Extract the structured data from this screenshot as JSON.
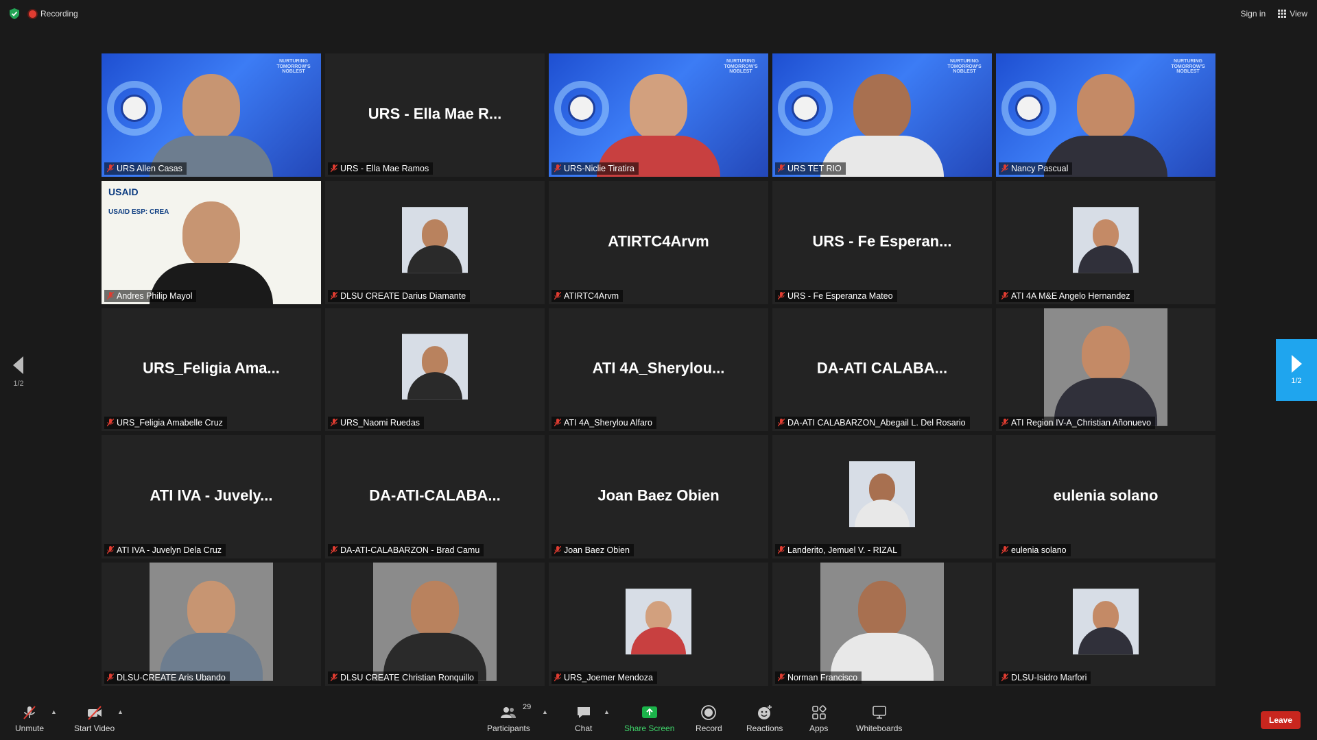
{
  "topbar": {
    "recording_label": "Recording",
    "sign_in": "Sign in",
    "view": "View"
  },
  "tiles": [
    {
      "display": "",
      "caption": "URS Allen Casas",
      "kind": "video-blue",
      "active": true
    },
    {
      "display": "URS - Ella Mae R...",
      "caption": "URS - Ella Mae Ramos",
      "kind": "name"
    },
    {
      "display": "",
      "caption": "URS-Niclie Tiratira",
      "kind": "video-blue"
    },
    {
      "display": "",
      "caption": "URS TET RIO",
      "kind": "video-blue"
    },
    {
      "display": "",
      "caption": "Nancy Pascual",
      "kind": "video-blue"
    },
    {
      "display": "",
      "caption": "Andres Philip Mayol",
      "kind": "video-white"
    },
    {
      "display": "",
      "caption": "DLSU CREATE Darius Diamante",
      "kind": "photo"
    },
    {
      "display": "ATIRTC4Arvm",
      "caption": "ATIRTC4Arvm",
      "kind": "name"
    },
    {
      "display": "URS - Fe Esperan...",
      "caption": "URS - Fe Esperanza Mateo",
      "kind": "name"
    },
    {
      "display": "",
      "caption": "ATI 4A M&E Angelo Hernandez",
      "kind": "photo"
    },
    {
      "display": "URS_Feligia  Ama...",
      "caption": "URS_Feligia Amabelle Cruz",
      "kind": "name"
    },
    {
      "display": "",
      "caption": "URS_Naomi Ruedas",
      "kind": "photo"
    },
    {
      "display": "ATI  4A_Sherylou...",
      "caption": "ATI 4A_Sherylou Alfaro",
      "kind": "name"
    },
    {
      "display": "DA-ATI  CALABA...",
      "caption": "DA-ATI CALABARZON_Abegail L. Del Rosario",
      "kind": "name"
    },
    {
      "display": "",
      "caption": "ATI Region IV-A_Christian Añonuevo",
      "kind": "photo-large"
    },
    {
      "display": "ATI IVA - Juvely...",
      "caption": "ATI IVA - Juvelyn Dela Cruz",
      "kind": "name"
    },
    {
      "display": "DA-ATI-CALABA...",
      "caption": "DA-ATI-CALABARZON - Brad Camu",
      "kind": "name"
    },
    {
      "display": "Joan Baez Obien",
      "caption": "Joan Baez Obien",
      "kind": "name"
    },
    {
      "display": "",
      "caption": "Landerito, Jemuel V. - RIZAL",
      "kind": "photo"
    },
    {
      "display": "eulenia solano",
      "caption": "eulenia solano",
      "kind": "name"
    },
    {
      "display": "",
      "caption": "DLSU-CREATE Aris Ubando",
      "kind": "photo-large"
    },
    {
      "display": "",
      "caption": "DLSU CREATE Christian Ronquillo",
      "kind": "photo-large"
    },
    {
      "display": "",
      "caption": "URS_Joemer Mendoza",
      "kind": "photo"
    },
    {
      "display": "",
      "caption": "Norman Francisco",
      "kind": "photo-large"
    },
    {
      "display": "",
      "caption": "DLSU-Isidro Marfori",
      "kind": "photo"
    }
  ],
  "video_text": {
    "motto": "NURTURING TOMORROW'S NOBLEST",
    "usaid": "USAID",
    "usaid_sub": "USAID ESP: CREA"
  },
  "pager": {
    "left": "1/2",
    "right": "1/2"
  },
  "toolbar": {
    "unmute": "Unmute",
    "start_video": "Start Video",
    "participants": "Participants",
    "participants_count": "29",
    "chat": "Chat",
    "share_screen": "Share Screen",
    "record": "Record",
    "reactions": "Reactions",
    "apps": "Apps",
    "whiteboards": "Whiteboards",
    "leave": "Leave"
  }
}
